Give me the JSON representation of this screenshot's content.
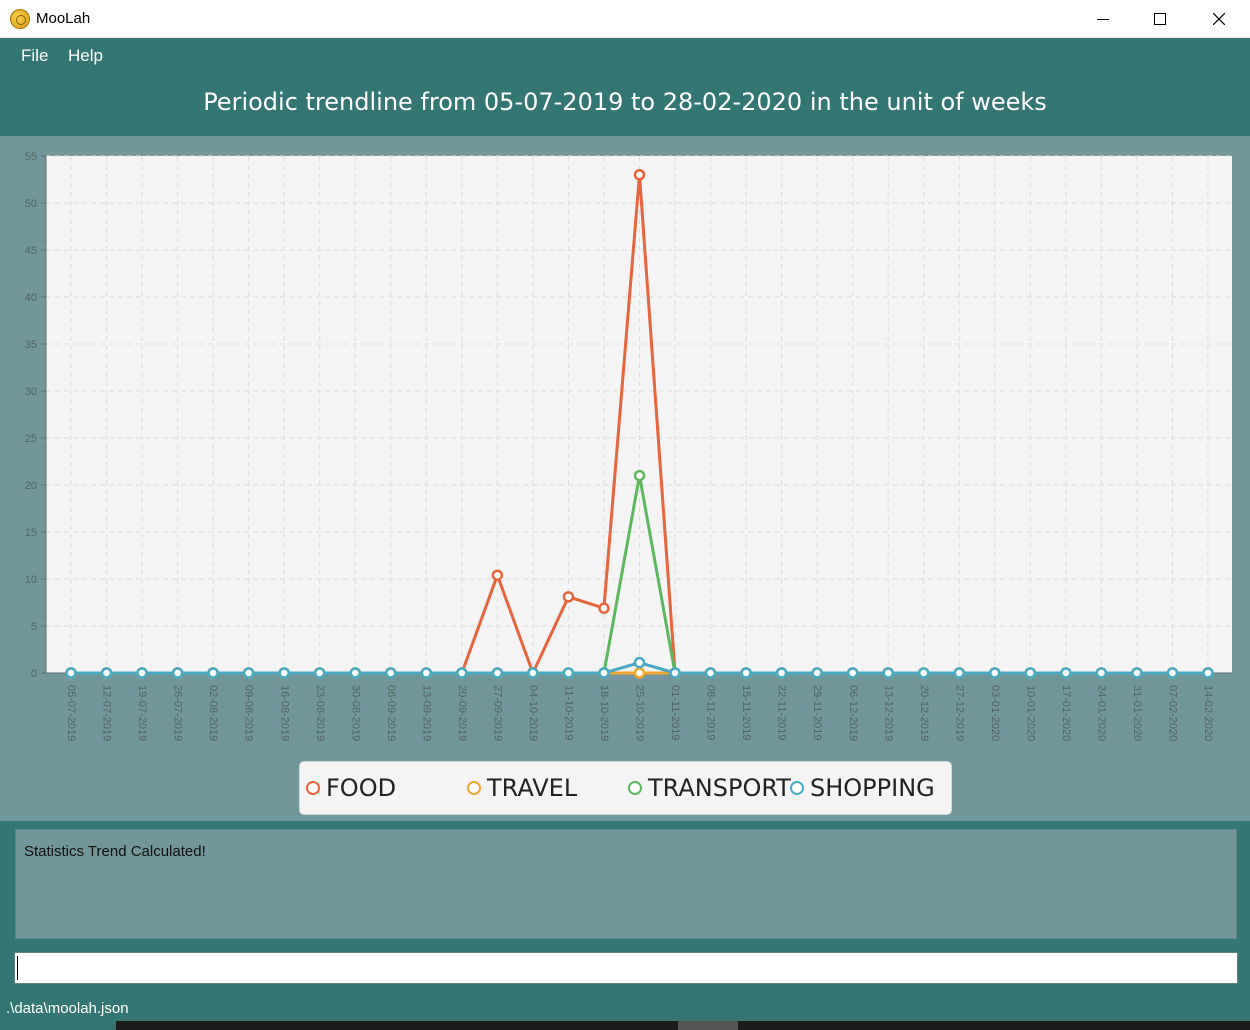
{
  "window": {
    "title": "MooLah",
    "controls": {
      "minimize": "minimize",
      "maximize": "maximize",
      "close": "close"
    }
  },
  "menu": {
    "file": "File",
    "help": "Help"
  },
  "header": {
    "title": "Periodic trendline from 05-07-2019 to 28-02-2020 in the unit of weeks"
  },
  "colors": {
    "accent": "#337673",
    "panel": "#72979b",
    "food": "#e8643a",
    "travel": "#f0a630",
    "transport": "#5bb85e",
    "shopping": "#4aa9c4"
  },
  "chart_data": {
    "type": "line",
    "title": "",
    "xlabel": "",
    "ylabel": "",
    "ylim": [
      0,
      55
    ],
    "y_ticks": [
      0,
      5,
      10,
      15,
      20,
      25,
      30,
      35,
      40,
      45,
      50,
      55
    ],
    "grid": true,
    "legend_position": "bottom",
    "categories": [
      "05-07-2019",
      "12-07-2019",
      "19-07-2019",
      "26-07-2019",
      "02-08-2019",
      "09-08-2019",
      "16-08-2019",
      "23-08-2019",
      "30-08-2019",
      "06-09-2019",
      "13-09-2019",
      "20-09-2019",
      "27-09-2019",
      "04-10-2019",
      "11-10-2019",
      "18-10-2019",
      "25-10-2019",
      "01-11-2019",
      "08-11-2019",
      "15-11-2019",
      "22-11-2019",
      "29-11-2019",
      "06-12-2019",
      "13-12-2019",
      "20-12-2019",
      "27-12-2019",
      "03-01-2020",
      "10-01-2020",
      "17-01-2020",
      "24-01-2020",
      "31-01-2020",
      "07-02-2020",
      "14-02-2020"
    ],
    "series": [
      {
        "name": "FOOD",
        "color": "#e8643a",
        "values": [
          0,
          0,
          0,
          0,
          0,
          0,
          0,
          0,
          0,
          0,
          0,
          0,
          10.4,
          0,
          8.1,
          6.9,
          53,
          0,
          0,
          0,
          0,
          0,
          0,
          0,
          0,
          0,
          0,
          0,
          0,
          0,
          0,
          0,
          0
        ]
      },
      {
        "name": "TRAVEL",
        "color": "#f0a630",
        "values": [
          0,
          0,
          0,
          0,
          0,
          0,
          0,
          0,
          0,
          0,
          0,
          0,
          0,
          0,
          0,
          0,
          0,
          0,
          0,
          0,
          0,
          0,
          0,
          0,
          0,
          0,
          0,
          0,
          0,
          0,
          0,
          0,
          0
        ]
      },
      {
        "name": "TRANSPORT",
        "color": "#5bb85e",
        "values": [
          0,
          0,
          0,
          0,
          0,
          0,
          0,
          0,
          0,
          0,
          0,
          0,
          0,
          0,
          0,
          0,
          21,
          0,
          0,
          0,
          0,
          0,
          0,
          0,
          0,
          0,
          0,
          0,
          0,
          0,
          0,
          0,
          0
        ]
      },
      {
        "name": "SHOPPING",
        "color": "#4aa9c4",
        "values": [
          0,
          0,
          0,
          0,
          0,
          0,
          0,
          0,
          0,
          0,
          0,
          0,
          0,
          0,
          0,
          0,
          1.1,
          0,
          0,
          0,
          0,
          0,
          0,
          0,
          0,
          0,
          0,
          0,
          0,
          0,
          0,
          0,
          0
        ]
      }
    ]
  },
  "result": {
    "text": "Statistics Trend Calculated!"
  },
  "command": {
    "value": "",
    "placeholder": ""
  },
  "status": {
    "path": ".\\data\\moolah.json"
  }
}
